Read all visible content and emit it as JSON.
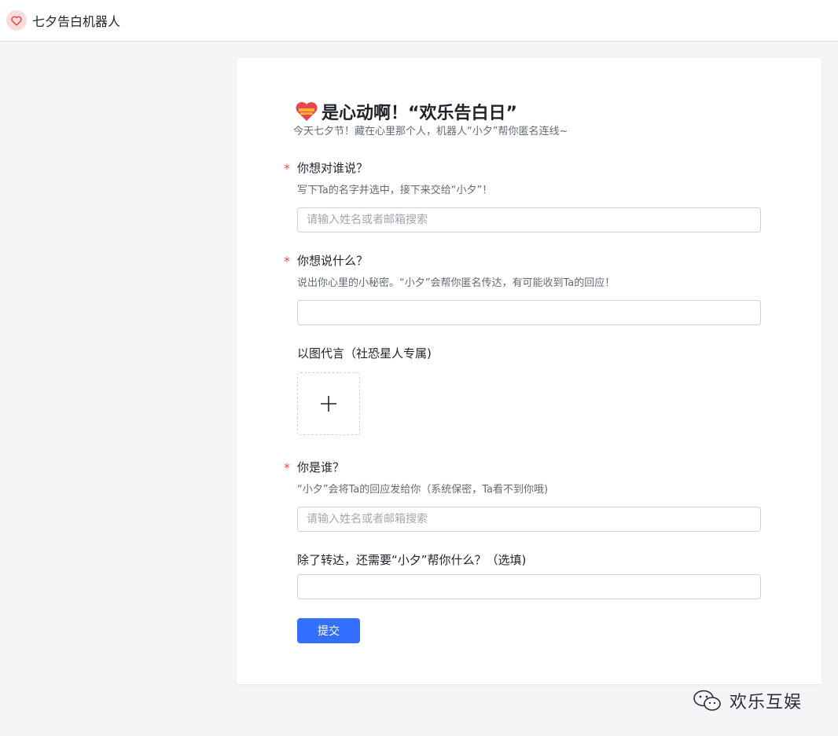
{
  "app": {
    "title": "七夕告白机器人"
  },
  "form": {
    "title": "是心动啊！“欢乐告白日”",
    "subtitle": "今天七夕节！藏在心里那个人，机器人“小夕”帮你匿名连线~",
    "fields": [
      {
        "required_mark": "*",
        "label": "你想对谁说？",
        "hint": "写下Ta的名字并选中，接下来交给“小夕”！",
        "placeholder": "请输入姓名或者邮箱搜索",
        "value": ""
      },
      {
        "required_mark": "*",
        "label": "你想说什么？",
        "hint": "说出你心里的小秘密。“小夕”会帮你匿名传达，有可能收到Ta的回应！",
        "placeholder": "",
        "value": ""
      },
      {
        "label": "以图代言（社恐星人专属)",
        "upload_icon": "plus-icon"
      },
      {
        "required_mark": "*",
        "label": "你是谁？",
        "hint": "“小夕”会将Ta的回应发给你（系统保密，Ta看不到你哦)",
        "placeholder": "请输入姓名或者邮箱搜索",
        "value": ""
      },
      {
        "label": "除了转达，还需要“小夕”帮你什么？（选填)",
        "placeholder": "",
        "value": ""
      }
    ],
    "submit_label": "提交"
  },
  "watermark": {
    "text": "欢乐互娱",
    "icon": "wechat-icon"
  },
  "colors": {
    "primary": "#3370ff",
    "required": "#f54a45",
    "logo_bg": "#f9dcdc",
    "heart": "#e8474f"
  }
}
